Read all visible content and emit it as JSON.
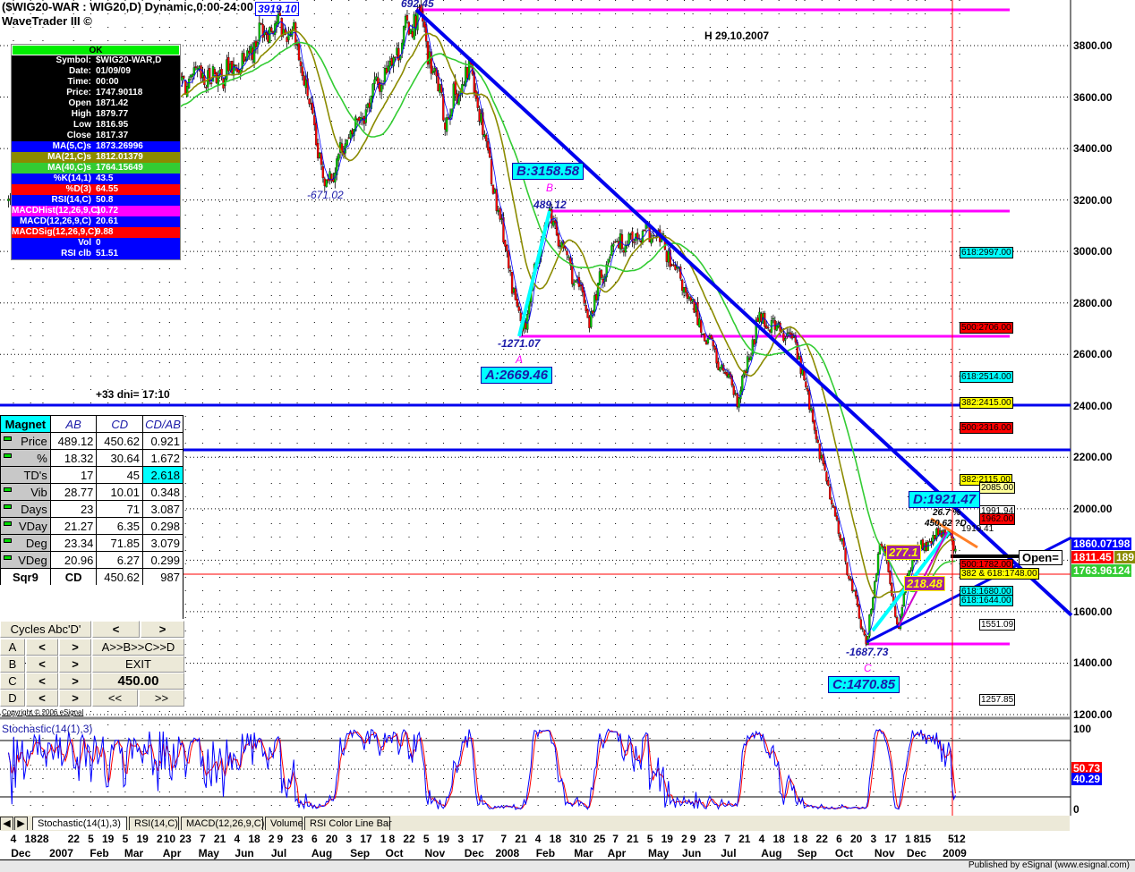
{
  "header": {
    "title": "($WIG20-WAR : WIG20,D) Dynamic,0:00-24:00",
    "subtitle": "WaveTrader III ©",
    "last_high_box": "3919.10"
  },
  "info_box": {
    "ok": "OK",
    "rows": [
      {
        "label": "Symbol:",
        "value": "$WIG20-WAR,D",
        "bg": "#000000"
      },
      {
        "label": "Date:",
        "value": "01/09/09",
        "bg": "#000000"
      },
      {
        "label": "Time:",
        "value": "00:00",
        "bg": "#000000"
      },
      {
        "label": "Price:",
        "value": "1747.90118",
        "bg": "#000000"
      },
      {
        "label": "Open",
        "value": "1871.42",
        "bg": "#000000"
      },
      {
        "label": "High",
        "value": "1879.77",
        "bg": "#000000"
      },
      {
        "label": "Low",
        "value": "1816.95",
        "bg": "#000000"
      },
      {
        "label": "Close",
        "value": "1817.37",
        "bg": "#000000"
      },
      {
        "label": "MA(5,C)s",
        "value": "1873.26996",
        "bg": "#0000ff"
      },
      {
        "label": "MA(21,C)s",
        "value": "1812.01379",
        "bg": "#8b8b00"
      },
      {
        "label": "MA(40,C)s",
        "value": "1764.15649",
        "bg": "#33cc33"
      },
      {
        "label": "%K(14,1)",
        "value": "43.5",
        "bg": "#0000ff"
      },
      {
        "label": "%D(3)",
        "value": "64.55",
        "bg": "#ff0000"
      },
      {
        "label": "RSI(14,C)",
        "value": "50.8",
        "bg": "#0000ff"
      },
      {
        "label": "MACDHist(12,26,9,C)",
        "value": "10.72",
        "bg": "#ff00ff"
      },
      {
        "label": "MACD(12,26,9,C)",
        "value": "20.61",
        "bg": "#0000ff"
      },
      {
        "label": "MACDSig(12,26,9,C)",
        "value": "9.88",
        "bg": "#ff0000"
      },
      {
        "label": "Vol",
        "value": "0",
        "bg": "#0000ff"
      },
      {
        "label": "RSI clb",
        "value": "51.51",
        "bg": "#0000ff"
      }
    ]
  },
  "magnet": {
    "headers": [
      "Magnet",
      "AB",
      "CD",
      "CD/AB"
    ],
    "rows": [
      {
        "label": "Price",
        "ab": "489.12",
        "cd": "450.62",
        "ratio": "0.921"
      },
      {
        "label": "%",
        "ab": "18.32",
        "cd": "30.64",
        "ratio": "1.672"
      },
      {
        "label": "TD's",
        "ab": "17",
        "cd": "45",
        "ratio": "2.618"
      },
      {
        "label": "Vib",
        "ab": "28.77",
        "cd": "10.01",
        "ratio": "0.348"
      },
      {
        "label": "Days",
        "ab": "23",
        "cd": "71",
        "ratio": "3.087"
      },
      {
        "label": "VDay",
        "ab": "21.27",
        "cd": "6.35",
        "ratio": "0.298"
      },
      {
        "label": "Deg",
        "ab": "23.34",
        "cd": "71.85",
        "ratio": "3.079"
      },
      {
        "label": "VDeg",
        "ab": "20.96",
        "cd": "6.27",
        "ratio": "0.299"
      }
    ],
    "sqr9": {
      "label": "Sqr9",
      "ab": "CD",
      "cd": "450.62",
      "ratio": "987"
    }
  },
  "cycles": {
    "title": "Cycles Abc'D'",
    "prev": "<",
    "next": ">",
    "rows": [
      "A",
      "B",
      "C",
      "D"
    ],
    "abcd": "A>>B>>C>>D",
    "exit": "EXIT",
    "value": "450.00",
    "rew": "<<",
    "fwd": ">>",
    "copyright": "Copyright © 2006 eSignal"
  },
  "annotations": {
    "days_note": "+33 dni= 17:10",
    "high_note": "H 29.10.2007",
    "p1": "-671.02",
    "p2": "692.45",
    "p3": "489.12",
    "p4": "-1271.07",
    "p5": "-1687.73",
    "B": "B",
    "A": "A",
    "C": "C",
    "B_box": "B:3158.58",
    "A_box": "A:2669.46",
    "C_box": "C:1470.85",
    "D_box": "D:1921.47",
    "pct": "26.7 %",
    "cd_est": "450.62 ?D",
    "p6": "1919.41",
    "box1": "277.1",
    "box2": "218.48",
    "open": "Open="
  },
  "fib_levels": [
    {
      "text": "618:2997.00",
      "bg": "#00ffff"
    },
    {
      "text": "500:2706.00",
      "bg": "#ff0000"
    },
    {
      "text": "618:2514.00",
      "bg": "#00ffff"
    },
    {
      "text": "382:2415.00",
      "bg": "#ffff00"
    },
    {
      "text": "500:2316.00",
      "bg": "#ff0000"
    },
    {
      "text": "382:2115.00",
      "bg": "#ffff00"
    },
    {
      "text": "2085.00",
      "bg": "#ffff99"
    },
    {
      "text": "1991.94",
      "bg": "#ffffff"
    },
    {
      "text": "1962.00",
      "bg": "#ff0000"
    },
    {
      "text": "500:1782.00",
      "bg": "#ff0000"
    },
    {
      "text": "382 & 618:1748.00",
      "bg": "#ffff00"
    },
    {
      "text": "618:1680.00",
      "bg": "#00ffff"
    },
    {
      "text": "618:1644.00",
      "bg": "#00ffff"
    },
    {
      "text": "1551.09",
      "bg": "#ffffff"
    },
    {
      "text": "1257.85",
      "bg": "#ffffff"
    }
  ],
  "price_tags": [
    {
      "text": "1860.07198",
      "bg": "#0000ff"
    },
    {
      "text": "1811.45",
      "tail": "189",
      "bg": "#ff0000"
    },
    {
      "text": "1763.96124",
      "bg": "#33cc33"
    }
  ],
  "stoch": {
    "label": "Stochastic(14(1),3)",
    "d_value": "50.73",
    "k_value": "40.29",
    "d_color": "#ff0000",
    "k_color": "#0000ff",
    "axis": [
      "100",
      "0"
    ]
  },
  "tabs": [
    "Stochastic(14(1),3)",
    "RSI(14,C)",
    "MACD(12,26,9,C)",
    "Volume",
    "RSI Color Line Bar"
  ],
  "footer": {
    "published": "Published by eSignal (www.esignal.com)"
  },
  "chart_data": {
    "type": "candlestick",
    "title": "($WIG20-WAR : WIG20,D)",
    "ylim": [
      1200,
      3950
    ],
    "y_ticks": [
      "3800.00",
      "3600.00",
      "3400.00",
      "3200.00",
      "3000.00",
      "2800.00",
      "2600.00",
      "2400.00",
      "2200.00",
      "2000.00",
      "1800.00",
      "1600.00",
      "1400.00",
      "1200.00"
    ],
    "pivots": [
      {
        "date": "2006-11-30",
        "price": 3200
      },
      {
        "date": "2007-04-21",
        "price": 3650
      },
      {
        "date": "2007-05-31",
        "price": 3700
      },
      {
        "date": "2007-06-30",
        "price": 3890
      },
      {
        "date": "2007-07-21",
        "price": 3850
      },
      {
        "date": "2007-08-14",
        "price": 3265
      },
      {
        "date": "2007-10-29",
        "price": 3935
      },
      {
        "date": "2007-11-20",
        "price": 3525
      },
      {
        "date": "2007-12-12",
        "price": 3717
      },
      {
        "date": "2008-01-22",
        "price": 2670
      },
      {
        "date": "2008-02-12",
        "price": 3158
      },
      {
        "date": "2008-03-17",
        "price": 2743
      },
      {
        "date": "2008-04-05",
        "price": 3040
      },
      {
        "date": "2008-05-11",
        "price": 3065
      },
      {
        "date": "2008-06-09",
        "price": 2778
      },
      {
        "date": "2008-07-16",
        "price": 2413
      },
      {
        "date": "2008-08-02",
        "price": 2755
      },
      {
        "date": "2008-09-01",
        "price": 2640
      },
      {
        "date": "2008-09-19",
        "price": 2240
      },
      {
        "date": "2008-10-28",
        "price": 1470
      },
      {
        "date": "2008-11-09",
        "price": 1890
      },
      {
        "date": "2008-11-23",
        "price": 1544
      },
      {
        "date": "2008-12-05",
        "price": 1822
      },
      {
        "date": "2009-01-03",
        "price": 1921
      },
      {
        "date": "2009-01-09",
        "price": 1817
      }
    ],
    "moving_averages": [
      {
        "name": "MA(5,C)",
        "color": "#0000ff"
      },
      {
        "name": "MA(21,C)",
        "color": "#8b8b00"
      },
      {
        "name": "MA(40,C)",
        "color": "#33cc33"
      }
    ],
    "x_day_ticks": [
      {
        "d": "4",
        "date": "2006-12-04"
      },
      {
        "d": "18",
        "date": "2006-12-18"
      },
      {
        "d": "28",
        "date": "2006-12-28"
      },
      {
        "d": "22",
        "date": "2007-01-22"
      },
      {
        "d": "5",
        "date": "2007-02-05"
      },
      {
        "d": "19",
        "date": "2007-02-19"
      },
      {
        "d": "5",
        "date": "2007-03-05"
      },
      {
        "d": "19",
        "date": "2007-03-19"
      },
      {
        "d": "2",
        "date": "2007-04-02"
      },
      {
        "d": "10",
        "date": "2007-04-10"
      },
      {
        "d": "23",
        "date": "2007-04-23"
      },
      {
        "d": "7",
        "date": "2007-05-07"
      },
      {
        "d": "21",
        "date": "2007-05-21"
      },
      {
        "d": "4",
        "date": "2007-06-04"
      },
      {
        "d": "18",
        "date": "2007-06-18"
      },
      {
        "d": "2",
        "date": "2007-07-02"
      },
      {
        "d": "9",
        "date": "2007-07-09"
      },
      {
        "d": "23",
        "date": "2007-07-23"
      },
      {
        "d": "6",
        "date": "2007-08-06"
      },
      {
        "d": "20",
        "date": "2007-08-20"
      },
      {
        "d": "3",
        "date": "2007-09-03"
      },
      {
        "d": "17",
        "date": "2007-09-17"
      },
      {
        "d": "1",
        "date": "2007-10-01"
      },
      {
        "d": "8",
        "date": "2007-10-08"
      },
      {
        "d": "22",
        "date": "2007-10-22"
      },
      {
        "d": "5",
        "date": "2007-11-05"
      },
      {
        "d": "19",
        "date": "2007-11-19"
      },
      {
        "d": "3",
        "date": "2007-12-03"
      },
      {
        "d": "17",
        "date": "2007-12-17"
      },
      {
        "d": "7",
        "date": "2008-01-07"
      },
      {
        "d": "21",
        "date": "2008-01-21"
      },
      {
        "d": "4",
        "date": "2008-02-04"
      },
      {
        "d": "18",
        "date": "2008-02-18"
      },
      {
        "d": "3",
        "date": "2008-03-03"
      },
      {
        "d": "10",
        "date": "2008-03-10"
      },
      {
        "d": "25",
        "date": "2008-03-25"
      },
      {
        "d": "7",
        "date": "2008-04-07"
      },
      {
        "d": "21",
        "date": "2008-04-21"
      },
      {
        "d": "5",
        "date": "2008-05-05"
      },
      {
        "d": "19",
        "date": "2008-05-19"
      },
      {
        "d": "2",
        "date": "2008-06-02"
      },
      {
        "d": "9",
        "date": "2008-06-09"
      },
      {
        "d": "23",
        "date": "2008-06-23"
      },
      {
        "d": "7",
        "date": "2008-07-07"
      },
      {
        "d": "21",
        "date": "2008-07-21"
      },
      {
        "d": "4",
        "date": "2008-08-04"
      },
      {
        "d": "18",
        "date": "2008-08-18"
      },
      {
        "d": "1",
        "date": "2008-09-01"
      },
      {
        "d": "8",
        "date": "2008-09-08"
      },
      {
        "d": "22",
        "date": "2008-09-22"
      },
      {
        "d": "6",
        "date": "2008-10-06"
      },
      {
        "d": "20",
        "date": "2008-10-20"
      },
      {
        "d": "3",
        "date": "2008-11-03"
      },
      {
        "d": "17",
        "date": "2008-11-17"
      },
      {
        "d": "1",
        "date": "2008-12-01"
      },
      {
        "d": "8",
        "date": "2008-12-08"
      },
      {
        "d": "15",
        "date": "2008-12-15"
      },
      {
        "d": "5",
        "date": "2009-01-05"
      },
      {
        "d": "12",
        "date": "2009-01-12"
      }
    ],
    "x_month_ticks": [
      {
        "m": "Dec",
        "date": "2006-12-10"
      },
      {
        "m": "2007",
        "date": "2007-01-12"
      },
      {
        "m": "Feb",
        "date": "2007-02-12"
      },
      {
        "m": "Mar",
        "date": "2007-03-12"
      },
      {
        "m": "Apr",
        "date": "2007-04-12"
      },
      {
        "m": "May",
        "date": "2007-05-12"
      },
      {
        "m": "Jun",
        "date": "2007-06-10"
      },
      {
        "m": "Jul",
        "date": "2007-07-08"
      },
      {
        "m": "Aug",
        "date": "2007-08-12"
      },
      {
        "m": "Sep",
        "date": "2007-09-12"
      },
      {
        "m": "Oct",
        "date": "2007-10-10"
      },
      {
        "m": "Nov",
        "date": "2007-11-12"
      },
      {
        "m": "Dec",
        "date": "2007-12-14"
      },
      {
        "m": "2008",
        "date": "2008-01-10"
      },
      {
        "m": "Feb",
        "date": "2008-02-10"
      },
      {
        "m": "Mar",
        "date": "2008-03-12"
      },
      {
        "m": "Apr",
        "date": "2008-04-08"
      },
      {
        "m": "May",
        "date": "2008-05-12"
      },
      {
        "m": "Jun",
        "date": "2008-06-08"
      },
      {
        "m": "Jul",
        "date": "2008-07-08"
      },
      {
        "m": "Aug",
        "date": "2008-08-12"
      },
      {
        "m": "Sep",
        "date": "2008-09-10"
      },
      {
        "m": "Oct",
        "date": "2008-10-10"
      },
      {
        "m": "Nov",
        "date": "2008-11-12"
      },
      {
        "m": "Dec",
        "date": "2008-12-08"
      },
      {
        "m": "2009",
        "date": "2009-01-08"
      }
    ]
  }
}
